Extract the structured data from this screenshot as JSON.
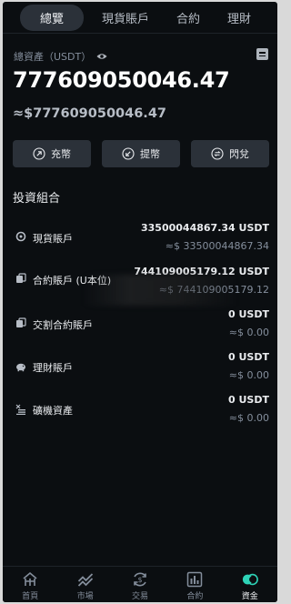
{
  "tabs": [
    {
      "label": "總覽",
      "active": true
    },
    {
      "label": "現貨賬戶",
      "active": false
    },
    {
      "label": "合約",
      "active": false
    },
    {
      "label": "理財",
      "active": false
    }
  ],
  "overview": {
    "total_label": "總資產（USDT）",
    "total_value": "777609050046.47",
    "total_approx": "≈$777609050046.47"
  },
  "actions": [
    {
      "label": "充幣",
      "icon": "deposit-icon"
    },
    {
      "label": "提幣",
      "icon": "withdraw-icon"
    },
    {
      "label": "閃兌",
      "icon": "swap-icon"
    }
  ],
  "portfolio": {
    "title": "投資組合",
    "accounts": [
      {
        "label": "現貨賬戶",
        "amount": "33500044867.34 USDT",
        "approx": "≈$ 33500044867.34",
        "icon": "spot-icon"
      },
      {
        "label": "合約賬戶 (U本位)",
        "amount": "744109005179.12 USDT",
        "approx": "≈$ 744109005179.12",
        "icon": "futures-icon"
      },
      {
        "label": "交割合約賬戶",
        "amount": "0 USDT",
        "approx": "≈$ 0.00",
        "icon": "delivery-icon"
      },
      {
        "label": "理財賬戶",
        "amount": "0 USDT",
        "approx": "≈$ 0.00",
        "icon": "piggy-bank-icon"
      },
      {
        "label": "礦機資產",
        "amount": "0 USDT",
        "approx": "≈$ 0.00",
        "icon": "mining-icon"
      }
    ]
  },
  "bottom_nav": [
    {
      "label": "首頁",
      "icon": "home-icon",
      "active": false
    },
    {
      "label": "市場",
      "icon": "market-icon",
      "active": false
    },
    {
      "label": "交易",
      "icon": "trade-icon",
      "active": false
    },
    {
      "label": "合約",
      "icon": "futures-nav-icon",
      "active": false
    },
    {
      "label": "資金",
      "icon": "wallet-icon",
      "active": true
    }
  ],
  "colors": {
    "background": "#0b0e11",
    "accent": "#2ed3b7",
    "muted": "#848e9c"
  }
}
